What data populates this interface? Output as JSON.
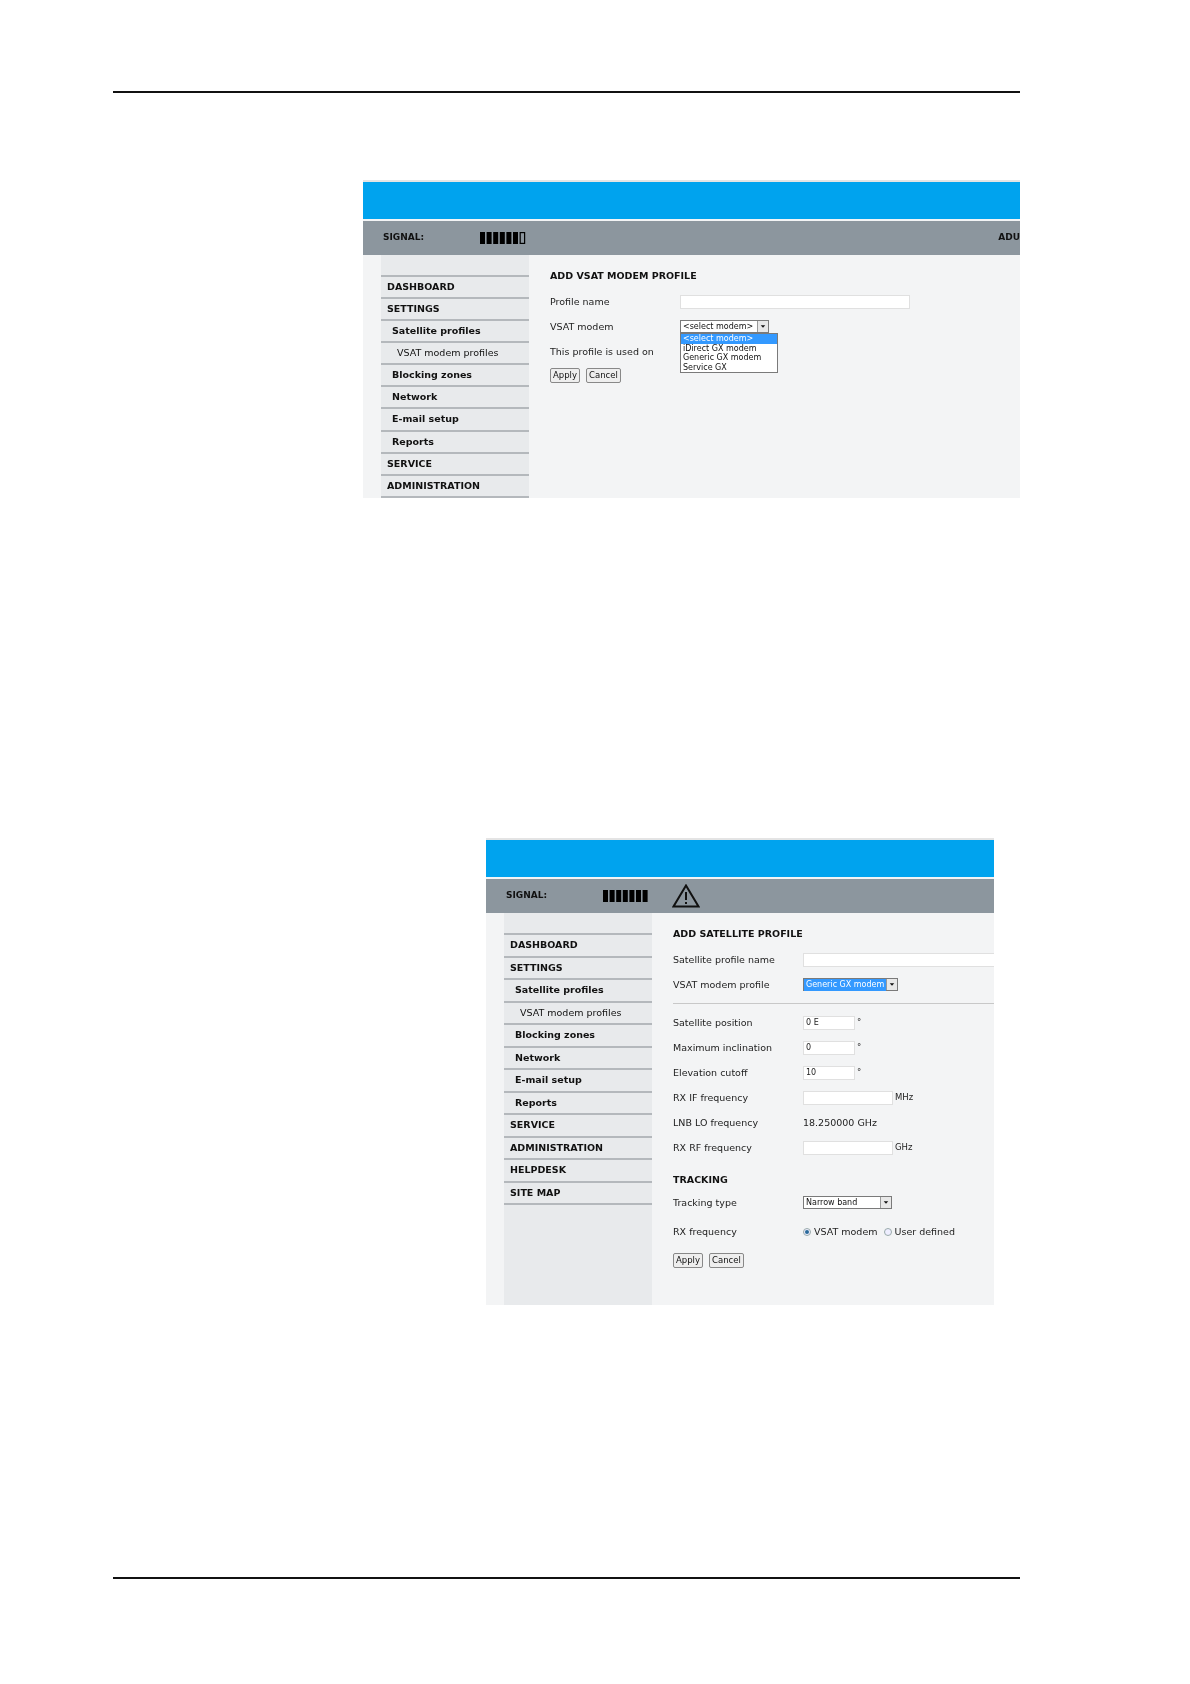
{
  "screens": [
    {
      "header": {
        "signal_label": "SIGNAL:",
        "status_text": "ADU",
        "warning": false
      },
      "sidebar": {
        "items": [
          {
            "label": "DASHBOARD"
          },
          {
            "label": "SETTINGS",
            "children": [
              {
                "label": "Satellite profiles",
                "children": [
                  {
                    "label": "VSAT modem profiles"
                  }
                ]
              },
              {
                "label": "Blocking zones"
              },
              {
                "label": "Network"
              },
              {
                "label": "E-mail setup"
              },
              {
                "label": "Reports"
              }
            ]
          },
          {
            "label": "SERVICE"
          },
          {
            "label": "ADMINISTRATION"
          }
        ]
      },
      "form": {
        "title": "ADD VSAT MODEM PROFILE",
        "rows": [
          {
            "kind": "textbox",
            "label": "Profile name"
          },
          {
            "kind": "select",
            "label": "VSAT modem",
            "value": "<select modem>",
            "highlighted": false,
            "open_options": [
              {
                "label": "<select modem>",
                "selected": true
              },
              {
                "label": "iDirect GX modem",
                "selected": false
              },
              {
                "label": "Generic GX modem",
                "selected": false
              },
              {
                "label": "Service GX",
                "selected": false
              }
            ]
          },
          {
            "kind": "label",
            "label": "This profile is used on"
          }
        ],
        "buttons": [
          "Apply",
          "Cancel"
        ]
      }
    },
    {
      "header": {
        "signal_label": "SIGNAL:",
        "warning": true
      },
      "sidebar": {
        "items": [
          {
            "label": "DASHBOARD"
          },
          {
            "label": "SETTINGS",
            "children": [
              {
                "label": "Satellite profiles",
                "children": [
                  {
                    "label": "VSAT modem profiles"
                  }
                ]
              },
              {
                "label": "Blocking zones"
              },
              {
                "label": "Network"
              },
              {
                "label": "E-mail setup"
              },
              {
                "label": "Reports"
              }
            ]
          },
          {
            "label": "SERVICE"
          },
          {
            "label": "ADMINISTRATION"
          },
          {
            "label": "HELPDESK"
          },
          {
            "label": "SITE MAP"
          }
        ]
      },
      "form": {
        "title": "ADD SATELLITE PROFILE",
        "rows": [
          {
            "kind": "textbox",
            "label": "Satellite profile name"
          },
          {
            "kind": "select",
            "label": "VSAT modem profile",
            "value": "Generic GX modem",
            "highlighted": true
          },
          {
            "kind": "divider"
          },
          {
            "kind": "anglebox",
            "label": "Satellite position",
            "value": "0 E",
            "unit": "°"
          },
          {
            "kind": "anglebox",
            "label": "Maximum inclination",
            "value": "0",
            "unit": "°"
          },
          {
            "kind": "anglebox",
            "label": "Elevation cutoff",
            "value": "10",
            "unit": "°"
          },
          {
            "kind": "freqbox",
            "label": "RX IF frequency",
            "unit": "MHz"
          },
          {
            "kind": "text",
            "label": "LNB LO frequency",
            "value": "18.250000 GHz"
          },
          {
            "kind": "freqbox",
            "label": "RX RF frequency",
            "unit": "GHz"
          },
          {
            "kind": "heading",
            "label": "TRACKING"
          },
          {
            "kind": "select",
            "label": "Tracking type",
            "value": "Narrow band",
            "highlighted": false
          },
          {
            "kind": "radio",
            "label": "RX frequency",
            "options": [
              {
                "label": "VSAT modem",
                "selected": true
              },
              {
                "label": "User defined",
                "selected": false
              }
            ]
          }
        ],
        "buttons": [
          "Apply",
          "Cancel"
        ]
      }
    }
  ]
}
